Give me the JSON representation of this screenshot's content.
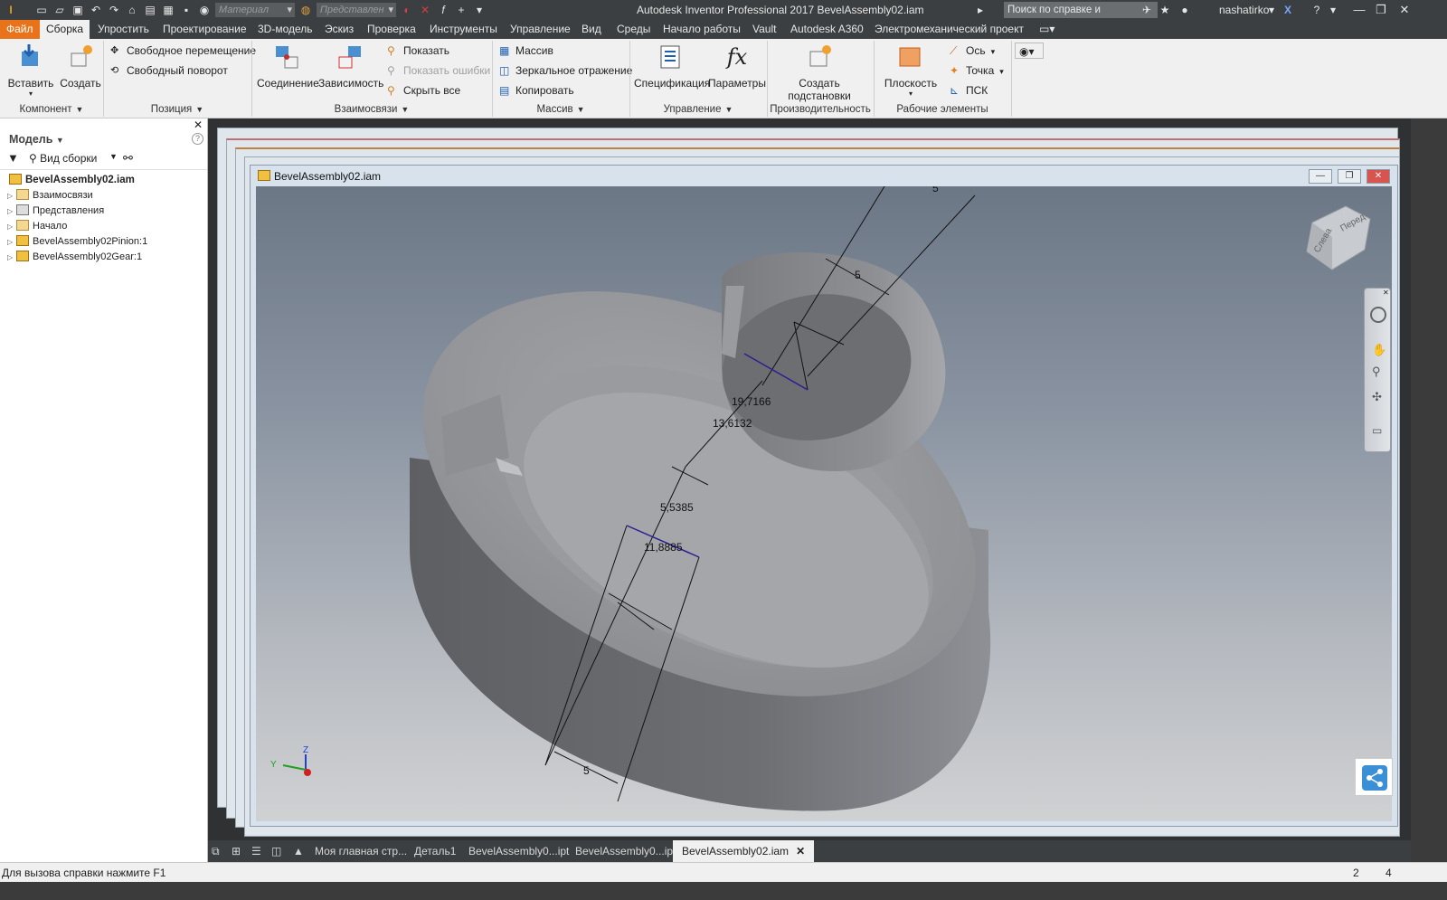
{
  "app": {
    "title": "Autodesk Inventor Professional 2017   BevelAssembly02.iam",
    "help_search_placeholder": "Поиск по справке и командам...",
    "user": "nashatirko",
    "qat": {
      "material": "Материал",
      "representation": "Представлен"
    }
  },
  "ribbon_tabs": [
    "Файл",
    "Сборка",
    "Упростить",
    "Проектирование",
    "3D-модель",
    "Эскиз",
    "Проверка",
    "Инструменты",
    "Управление",
    "Вид",
    "Среды",
    "Начало работы",
    "Vault",
    "Autodesk A360",
    "Электромеханический проект"
  ],
  "ribbon": {
    "component": {
      "title": "Компонент",
      "insert": "Вставить",
      "create": "Создать"
    },
    "position": {
      "title": "Позиция",
      "free_move": "Свободное перемещение",
      "free_rotate": "Свободный поворот"
    },
    "relationships": {
      "title": "Взаимосвязи",
      "joint": "Соединение",
      "constrain": "Зависимость",
      "show": "Показать",
      "show_errors": "Показать ошибки",
      "hide_all": "Скрыть все"
    },
    "pattern": {
      "title": "Массив",
      "pattern": "Массив",
      "mirror": "Зеркальное отражение",
      "copy": "Копировать"
    },
    "manage": {
      "title": "Управление",
      "bom": "Спецификация",
      "params": "Параметры"
    },
    "productivity": {
      "title": "Производительность",
      "substitute_1": "Создать",
      "substitute_2": "подстановки"
    },
    "work_features": {
      "title": "Рабочие элементы",
      "plane": "Плоскость",
      "axis": "Ось",
      "point": "Точка",
      "ucs": "ПСК"
    }
  },
  "browser": {
    "title": "Модель",
    "view": "Вид сборки",
    "root": "BevelAssembly02.iam",
    "items": [
      "Взаимосвязи",
      "Представления",
      "Начало",
      "BevelAssembly02Pinion:1",
      "BevelAssembly02Gear:1"
    ]
  },
  "document": {
    "window_title": "BevelAssembly02.iam",
    "dimensions": [
      "5",
      "5",
      "19,7166",
      "13,6132",
      "5,5385",
      "11,8885",
      "5"
    ],
    "viewcube": {
      "left": "Слева",
      "front": "Перед"
    }
  },
  "doc_tabs": [
    "Моя главная стр...",
    "Деталь1",
    "BevelAssembly0...ipt",
    "BevelAssembly0...ipt",
    "BevelAssembly02.iam"
  ],
  "status": {
    "message": "Для вызова справки нажмите F1",
    "count_a": "2",
    "count_b": "4"
  },
  "colors": {
    "file_tab": "#e8731a",
    "dark_chrome": "#3c3f41",
    "ribbon": "#f0f0f0"
  }
}
